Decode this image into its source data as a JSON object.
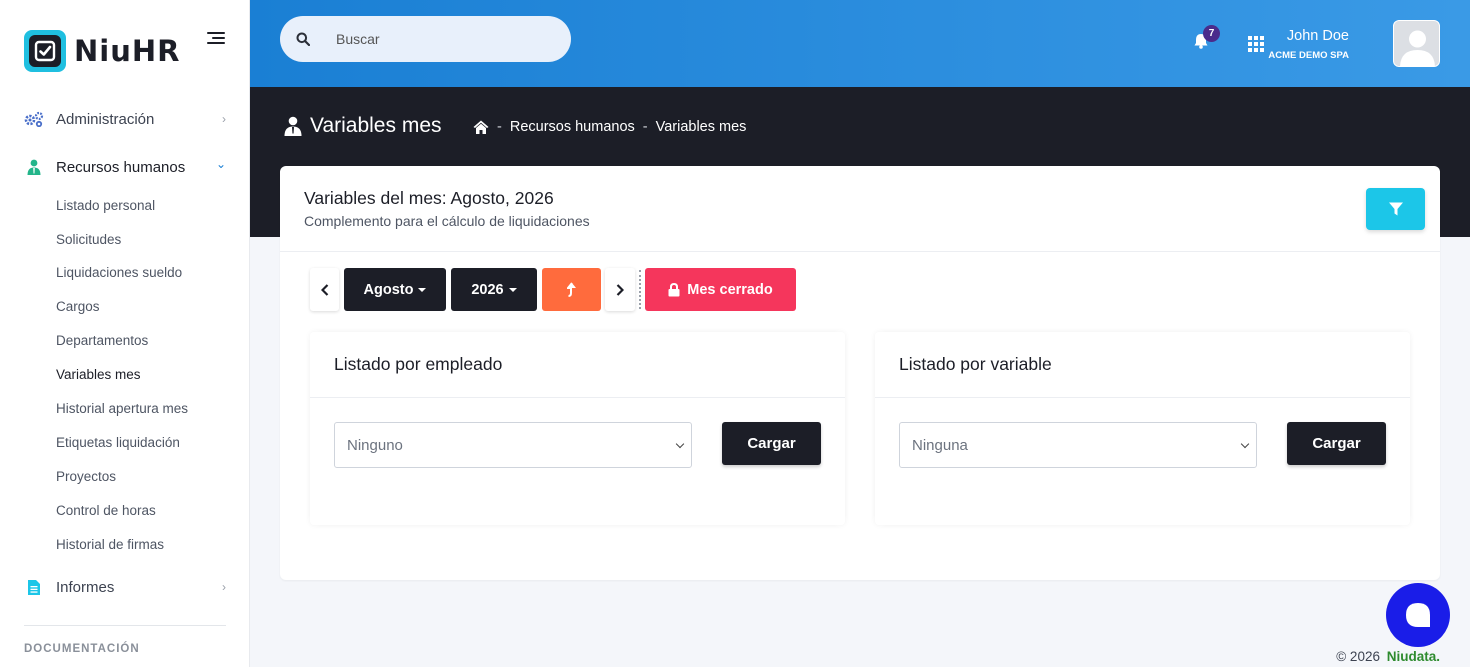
{
  "brand": {
    "name": "NiuHR"
  },
  "sidebar": {
    "items": [
      {
        "label": "Administración"
      },
      {
        "label": "Recursos humanos"
      },
      {
        "label": "Informes"
      }
    ],
    "sub_items": [
      {
        "label": "Listado personal"
      },
      {
        "label": "Solicitudes"
      },
      {
        "label": "Liquidaciones sueldo"
      },
      {
        "label": "Cargos"
      },
      {
        "label": "Departamentos"
      },
      {
        "label": "Variables mes"
      },
      {
        "label": "Historial apertura mes"
      },
      {
        "label": "Etiquetas liquidación"
      },
      {
        "label": "Proyectos"
      },
      {
        "label": "Control de horas"
      },
      {
        "label": "Historial de firmas"
      }
    ],
    "section_label": "DOCUMENTACIÓN"
  },
  "header": {
    "search_placeholder": "Buscar",
    "notification_count": "7",
    "user_name": "John Doe",
    "user_company": "ACME DEMO SPA"
  },
  "page": {
    "title": "Variables mes",
    "breadcrumb": [
      "Recursos humanos",
      "Variables mes"
    ]
  },
  "card": {
    "title": "Variables del mes: Agosto, 2026",
    "subtitle": "Complemento para el cálculo de liquidaciones",
    "month_label": "Agosto",
    "year_label": "2026",
    "closed_label": "Mes cerrado"
  },
  "employee_panel": {
    "title": "Listado por empleado",
    "select_value": "Ninguno",
    "button_label": "Cargar"
  },
  "variable_panel": {
    "title": "Listado por variable",
    "select_value": "Ninguna",
    "button_label": "Cargar"
  },
  "footer": {
    "copyright": "© 2026",
    "company": "Niudata."
  },
  "colors": {
    "accent": "#1cc6e8",
    "dark": "#1c1e27",
    "orange": "#ff6b3d",
    "danger": "#f5365c",
    "header_blue": "#1a7fd4"
  }
}
